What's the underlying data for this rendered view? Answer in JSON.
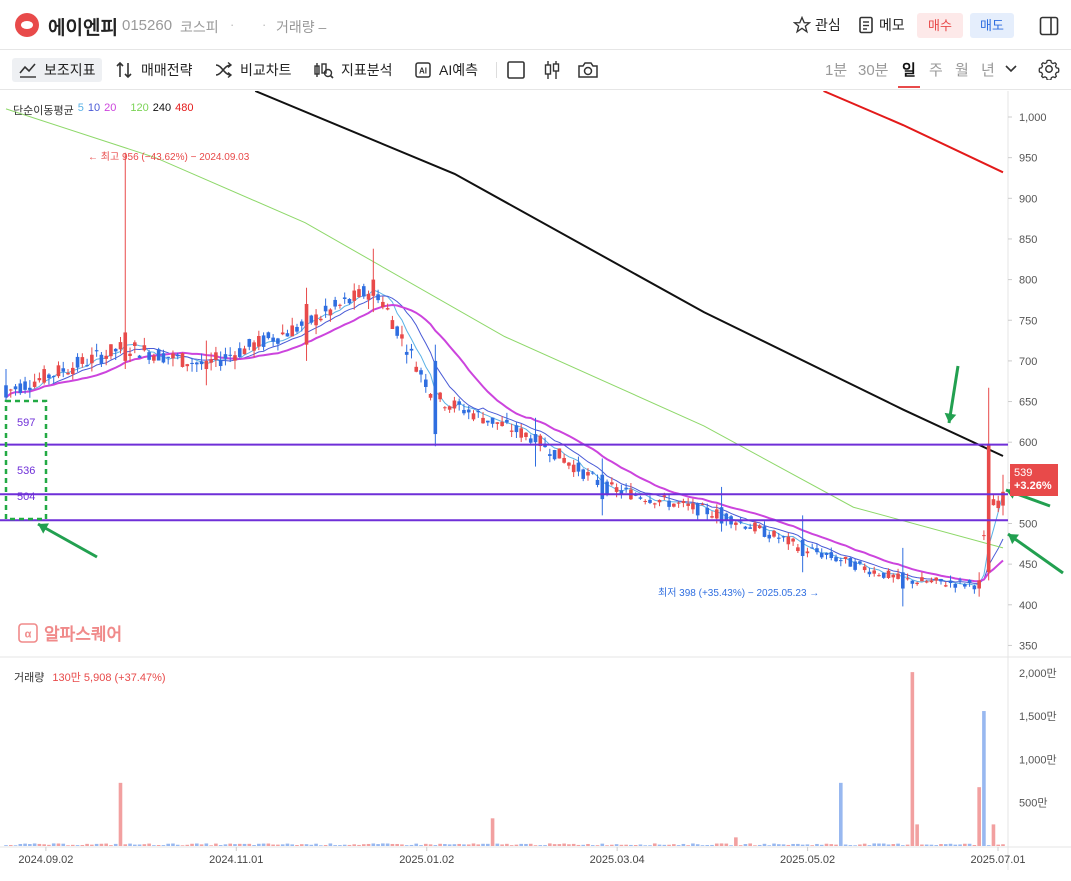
{
  "header": {
    "stock_name": "에이엔피",
    "stock_code": "015260",
    "market": "코스피",
    "dot": "·",
    "volume_label": "거래량 –",
    "favorite_label": "관심",
    "memo_label": "메모",
    "buy_label": "매수",
    "sell_label": "매도"
  },
  "toolbar": {
    "indicators_label": "보조지표",
    "strategy_label": "매매전략",
    "compare_label": "비교차트",
    "analysis_label": "지표분석",
    "ai_label": "AI예측",
    "periods": [
      "1분",
      "30분",
      "일",
      "주",
      "월",
      "년"
    ],
    "active_period": "일"
  },
  "colors": {
    "up": "#e84a4a",
    "down": "#2f6ee0",
    "ma5": "#5bb2e6",
    "ma10": "#4a5bd6",
    "ma20": "#cc44dd",
    "ma120": "#8ed86a",
    "ma240": "#111111",
    "ma480": "#e31a1a",
    "level_line": "#6f2fd8",
    "annotation_box": "#22aa44",
    "arrow": "#22a050"
  },
  "watermark": "알파스퀘어",
  "chart_data": [
    {
      "type": "candlestick",
      "legend": {
        "title": "단순이동평균",
        "periods": [
          "5",
          "10",
          "20",
          "120",
          "240",
          "480"
        ]
      },
      "y_ticks": [
        "1,000",
        "950",
        "900",
        "850",
        "800",
        "750",
        "700",
        "650",
        "600",
        "550",
        "500",
        "450",
        "400",
        "350"
      ],
      "ylim": [
        337,
        1032
      ],
      "x_ticks": [
        "2024.09.02",
        "2024.11.01",
        "2025.01.02",
        "2025.03.04",
        "2025.05.02",
        "2025.07.01"
      ],
      "high_annotation": "최고 956 (−43.62%) − 2024.09.03",
      "low_annotation": "최저 398 (+35.43%) − 2025.05.23",
      "levels": [
        597,
        536,
        504
      ],
      "level_labels": [
        "597",
        "536",
        "504"
      ],
      "last_price": "539",
      "last_change": "+3.26%",
      "ohlc_anchors": [
        {
          "t": 0,
          "o": 670,
          "h": 690,
          "l": 650,
          "c": 655
        },
        {
          "t": 0.12,
          "o": 700,
          "h": 956,
          "l": 690,
          "c": 735
        },
        {
          "t": 0.2,
          "o": 690,
          "h": 725,
          "l": 670,
          "c": 700
        },
        {
          "t": 0.3,
          "o": 720,
          "h": 790,
          "l": 700,
          "c": 770
        },
        {
          "t": 0.37,
          "o": 780,
          "h": 838,
          "l": 760,
          "c": 800
        },
        {
          "t": 0.43,
          "o": 700,
          "h": 720,
          "l": 595,
          "c": 610
        },
        {
          "t": 0.53,
          "o": 610,
          "h": 630,
          "l": 570,
          "c": 600
        },
        {
          "t": 0.6,
          "o": 560,
          "h": 580,
          "l": 510,
          "c": 530
        },
        {
          "t": 0.72,
          "o": 520,
          "h": 545,
          "l": 490,
          "c": 500
        },
        {
          "t": 0.8,
          "o": 480,
          "h": 510,
          "l": 440,
          "c": 460
        },
        {
          "t": 0.9,
          "o": 440,
          "h": 470,
          "l": 398,
          "c": 420
        },
        {
          "t": 0.975,
          "o": 420,
          "h": 440,
          "l": 410,
          "c": 430
        },
        {
          "t": 0.985,
          "o": 440,
          "h": 667,
          "l": 430,
          "c": 598
        },
        {
          "t": 1,
          "o": 522,
          "h": 560,
          "l": 510,
          "c": 539
        }
      ],
      "moving_averages": {
        "ma120": [
          [
            0,
            1010
          ],
          [
            0.15,
            950
          ],
          [
            0.3,
            870
          ],
          [
            0.5,
            730
          ],
          [
            0.7,
            620
          ],
          [
            0.85,
            520
          ],
          [
            1,
            470
          ]
        ],
        "ma240": [
          [
            0.25,
            1032
          ],
          [
            0.45,
            930
          ],
          [
            0.7,
            760
          ],
          [
            0.9,
            640
          ],
          [
            1,
            583
          ]
        ],
        "ma480": [
          [
            0.82,
            1032
          ],
          [
            0.9,
            990
          ],
          [
            1,
            932
          ]
        ]
      }
    },
    {
      "type": "bar",
      "title": "거래량",
      "value_label": "130만 5,908 (+37.47%)",
      "y_ticks": [
        "2,000만",
        "1,500만",
        "1,000만",
        "500만"
      ],
      "ylim": [
        0,
        2150
      ],
      "unit": "만",
      "spikes": [
        {
          "t": 0.115,
          "v": 730,
          "dir": "up"
        },
        {
          "t": 0.49,
          "v": 320,
          "dir": "up"
        },
        {
          "t": 0.73,
          "v": 100,
          "dir": "up"
        },
        {
          "t": 0.835,
          "v": 730,
          "dir": "down"
        },
        {
          "t": 0.91,
          "v": 2010,
          "dir": "up"
        },
        {
          "t": 0.915,
          "v": 250,
          "dir": "up"
        },
        {
          "t": 0.975,
          "v": 680,
          "dir": "up"
        },
        {
          "t": 0.983,
          "v": 1560,
          "dir": "down"
        },
        {
          "t": 0.99,
          "v": 250,
          "dir": "up"
        }
      ]
    }
  ]
}
